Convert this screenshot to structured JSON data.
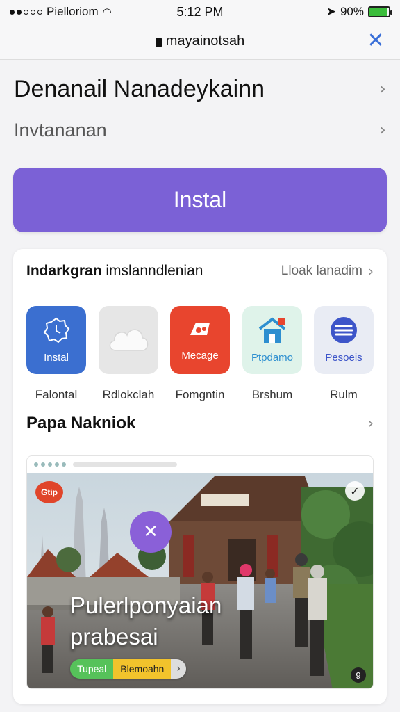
{
  "status_bar": {
    "carrier": "Pielloriom",
    "time": "5:12 PM",
    "battery_percent": "90%",
    "battery_level": 0.9,
    "battery_color": "#3bbd3b"
  },
  "address_bar": {
    "url": "mayainotsah",
    "close_icon": "close-icon"
  },
  "header": {
    "title": "Denanail Nanadeykainn",
    "subtitle": "Invtananan"
  },
  "install_button": {
    "label": "Instal",
    "color": "#7b61d6"
  },
  "related": {
    "heading_bold": "Indarkgran",
    "heading_rest": " imslanndlenian",
    "more_label": "Lloak lanadim",
    "apps": [
      {
        "tile_label": "Instal",
        "name": "Falontal",
        "icon": "clock-badge-icon",
        "bg": "#3b6fd0",
        "fg": "#ffffff"
      },
      {
        "tile_label": "",
        "name": "Rdlokclah",
        "icon": "cloud-icon",
        "bg": "#e6e6e6",
        "fg": "#ffffff"
      },
      {
        "tile_label": "Mecage",
        "name": "Fomgntin",
        "icon": "music-icon",
        "bg": "#e8452e",
        "fg": "#ffffff"
      },
      {
        "tile_label": "Ptpdamo",
        "name": "Brshum",
        "icon": "house-icon",
        "bg": "#dff3ea",
        "fg": "#2d8fd0"
      },
      {
        "tile_label": "Pesoeis",
        "name": "Rulm",
        "icon": "layers-icon",
        "bg": "#e9ecf4",
        "fg": "#3d55c9"
      }
    ]
  },
  "section2": {
    "heading": "Papa Nakniok"
  },
  "feature": {
    "title_line1": "Pulerlponyaian",
    "title_line2": "prabesai",
    "badge_text": "Gtip",
    "pill_1": "Tupeal",
    "pill_2": "Blemoahn",
    "pill_3": "›"
  }
}
